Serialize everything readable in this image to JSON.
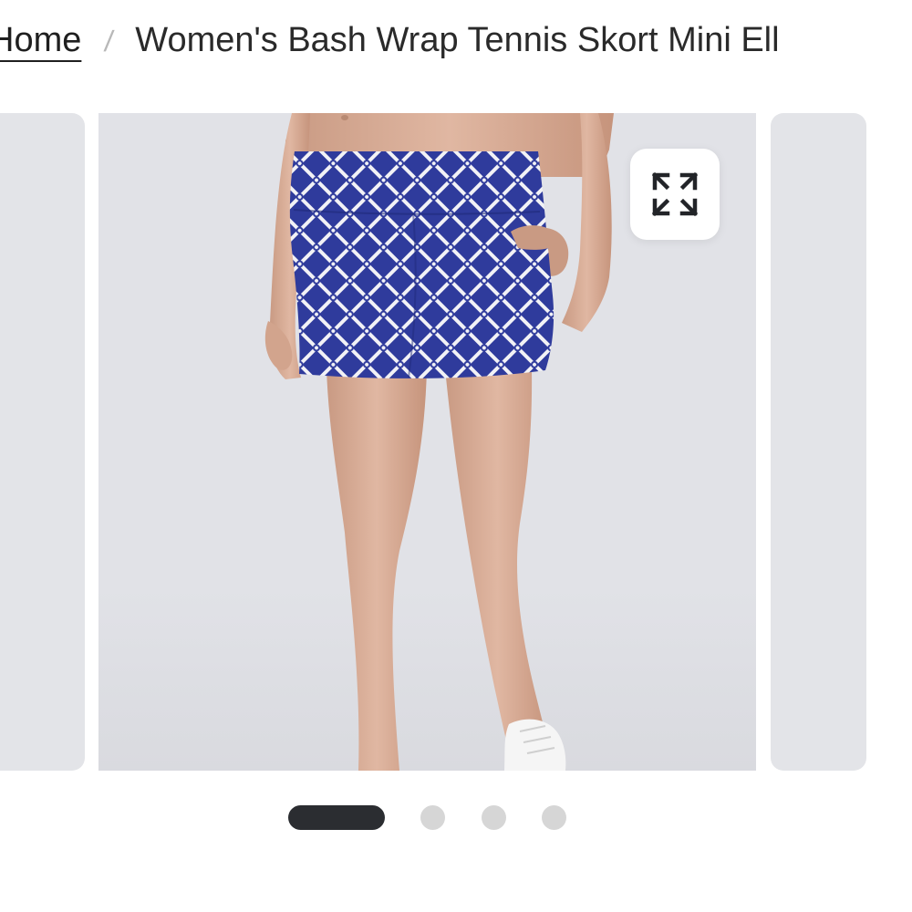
{
  "breadcrumb": {
    "home_label": "Home",
    "separator": "/",
    "current_label": "Women's Bash Wrap Tennis Skort Mini Ell"
  },
  "gallery": {
    "expand_icon": "expand-arrows-icon",
    "slide_count": 4,
    "active_index": 0
  },
  "colors": {
    "skort_blue": "#2f3b9c",
    "background": "#e1e2e7",
    "active_dot": "#2b2d31",
    "inactive_dot": "#d6d6d6"
  }
}
